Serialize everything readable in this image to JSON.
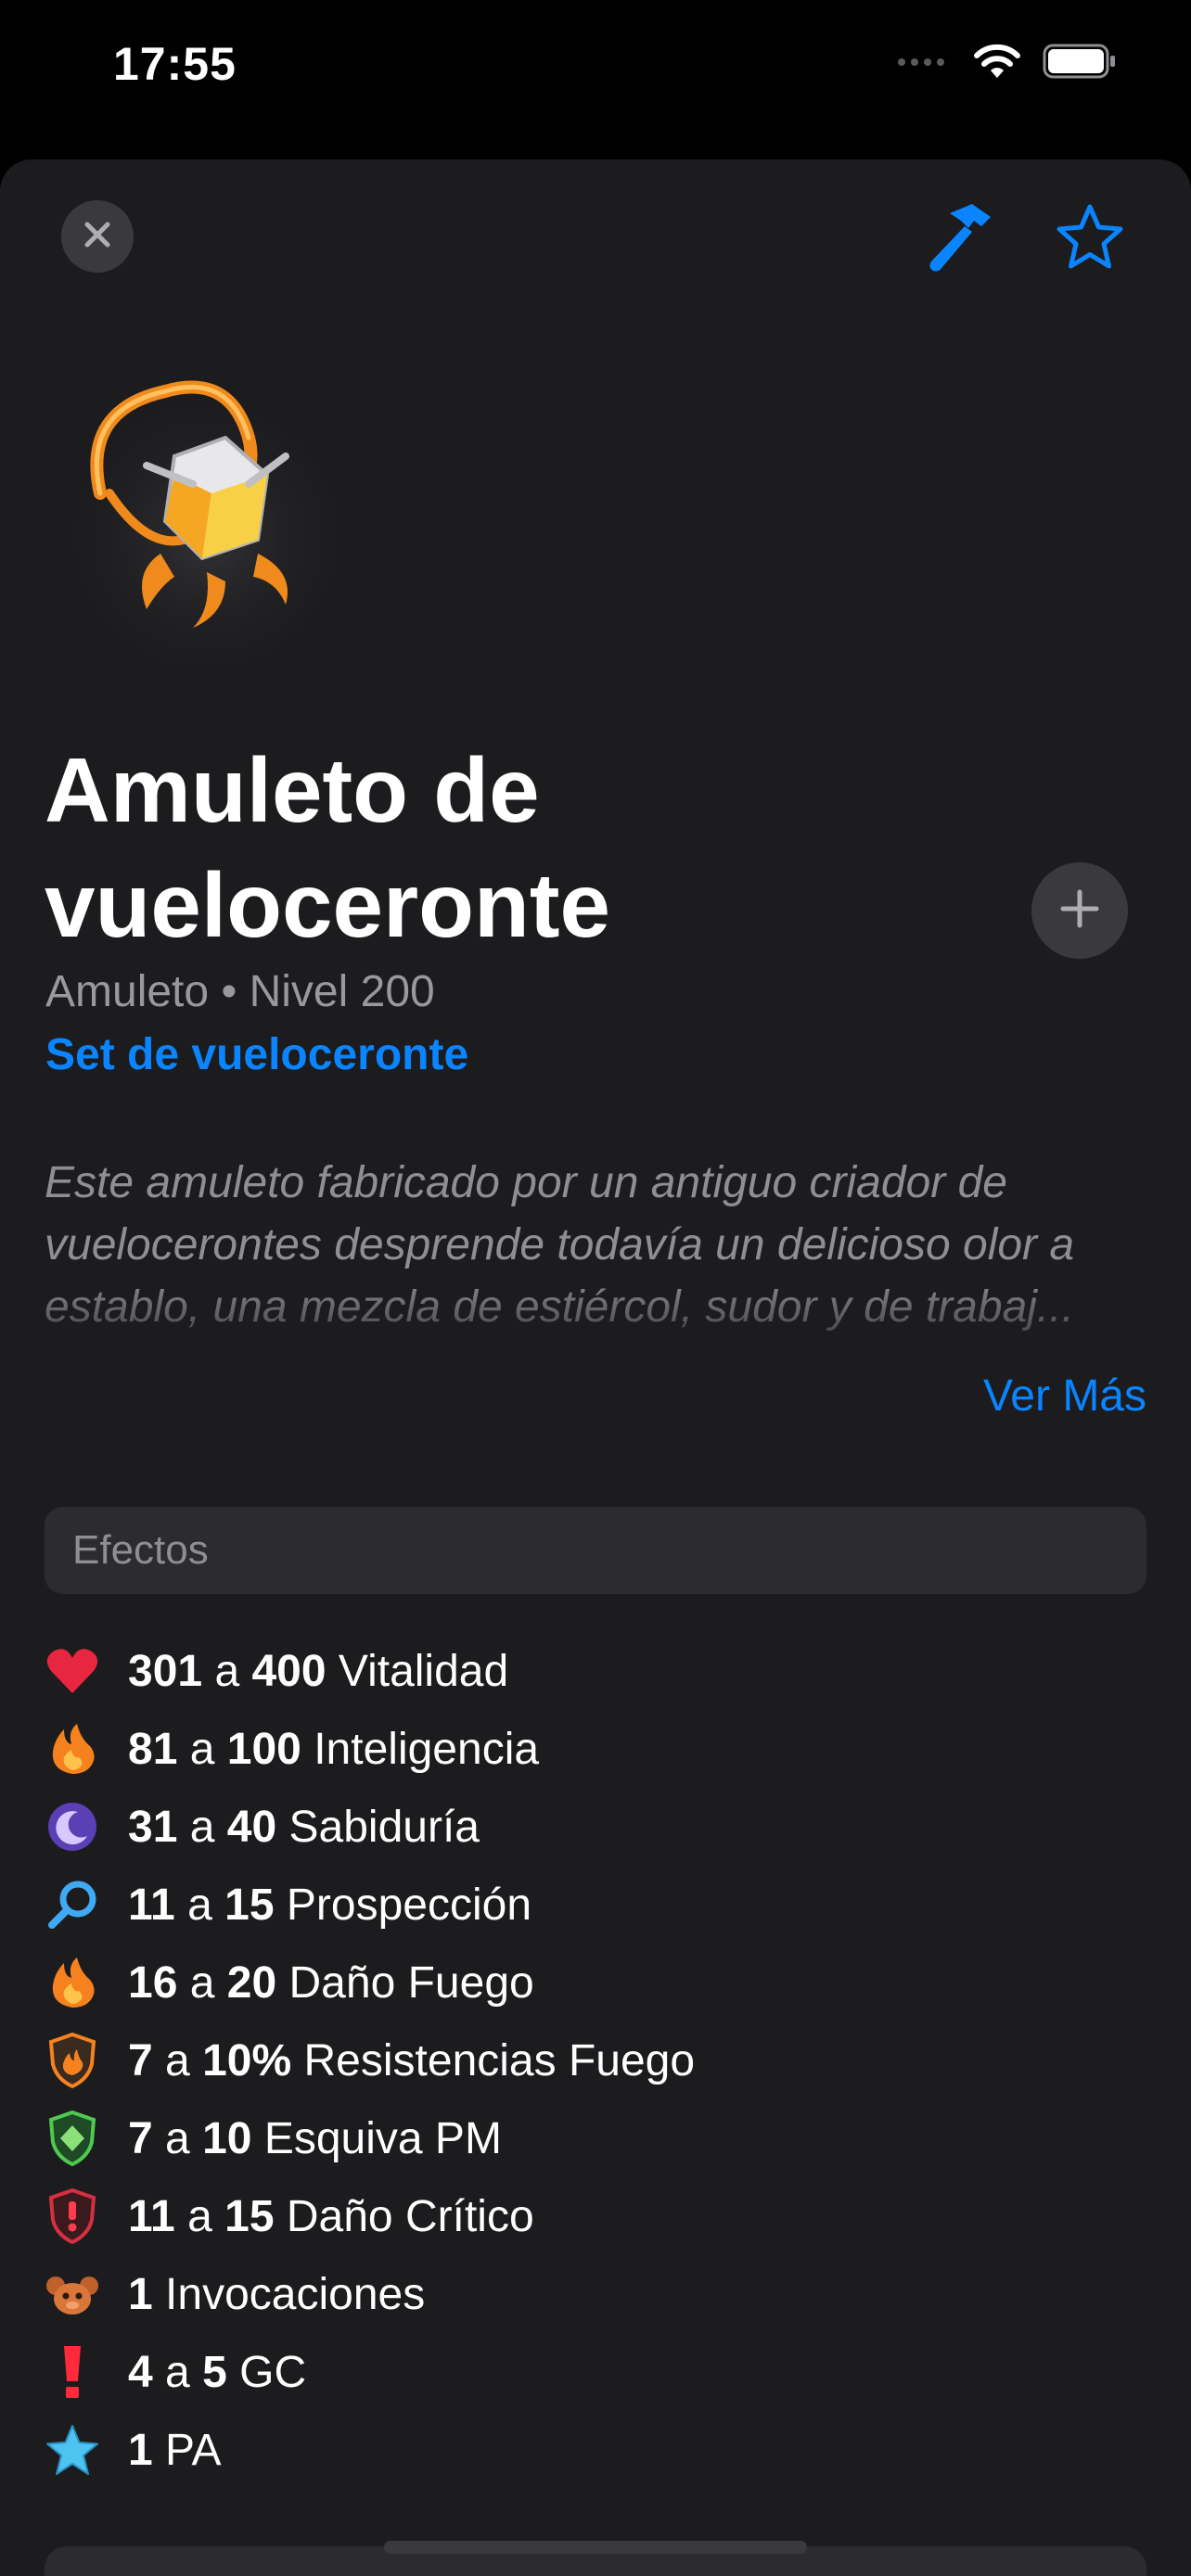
{
  "status_bar": {
    "time": "17:55"
  },
  "colors": {
    "accent": "#0a84ff",
    "background": "#1c1c1e",
    "secondary_text": "#98989d"
  },
  "toolbar": {
    "close_icon": "close-icon",
    "craft_icon": "hammer-icon",
    "favorite_icon": "star-icon"
  },
  "item": {
    "title": "Amuleto de vueloceronte",
    "type": "Amuleto",
    "separator": "•",
    "level": "Nivel 200",
    "set_link": "Set de vueloceronte",
    "description": "Este amuleto fabricado por un antiguo criador de vuelocerontes desprende todavía un delicioso olor a establo, una mezcla de estiércol, sudor y de trabaj...",
    "ver_mas": "Ver Más"
  },
  "effects": {
    "header": "Efectos",
    "items": [
      {
        "icon": "heart-icon",
        "min": "301",
        "joiner": "a",
        "max": "400",
        "label": "Vitalidad"
      },
      {
        "icon": "fire-icon",
        "min": "81",
        "joiner": "a",
        "max": "100",
        "label": "Inteligencia"
      },
      {
        "icon": "moon-icon",
        "min": "31",
        "joiner": "a",
        "max": "40",
        "label": "Sabiduría"
      },
      {
        "icon": "magnifier-icon",
        "min": "11",
        "joiner": "a",
        "max": "15",
        "label": "Prospección"
      },
      {
        "icon": "fire-icon",
        "min": "16",
        "joiner": "a",
        "max": "20",
        "label": "Daño Fuego"
      },
      {
        "icon": "fire-shield-icon",
        "min": "7",
        "joiner": "a",
        "max": "10%",
        "label": "Resistencias Fuego"
      },
      {
        "icon": "green-shield-icon",
        "min": "7",
        "joiner": "a",
        "max": "10",
        "label": "Esquiva PM"
      },
      {
        "icon": "critical-shield-icon",
        "min": "11",
        "joiner": "a",
        "max": "15",
        "label": "Daño Crítico"
      },
      {
        "icon": "summon-icon",
        "min": "1",
        "joiner": "",
        "max": "",
        "label": "Invocaciones"
      },
      {
        "icon": "exclamation-icon",
        "min": "4",
        "joiner": "a",
        "max": "5",
        "label": "GC"
      },
      {
        "icon": "blue-star-icon",
        "min": "1",
        "joiner": "",
        "max": "",
        "label": "PA"
      }
    ]
  }
}
